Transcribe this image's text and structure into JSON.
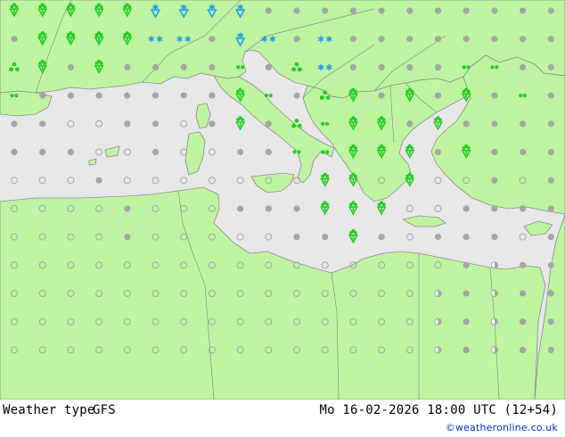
{
  "footer": {
    "weather_type_label": "Weather type",
    "model": "GFS",
    "datetime": "Mo 16-02-2026 18:00 UTC (12+54)",
    "credit": "©weatheronline.co.uk"
  },
  "colors": {
    "land": "#bff5a0",
    "sea": "#e8e8e8",
    "border": "#8a8a8a",
    "cloud_dot": "#a5a5a5",
    "rain": "#22cc22",
    "snow": "#1e9ef0"
  },
  "symbol_legend": {
    "cloudy": "grey dot",
    "partly-cloudy": "grey half dot",
    "clear": "open circle",
    "showers": "green shower arrow",
    "thunder": "green triple drops",
    "drizzle": "green double dots",
    "snow-shower": "blue snow arrow",
    "snow-flakes": "blue asterisks"
  }
}
